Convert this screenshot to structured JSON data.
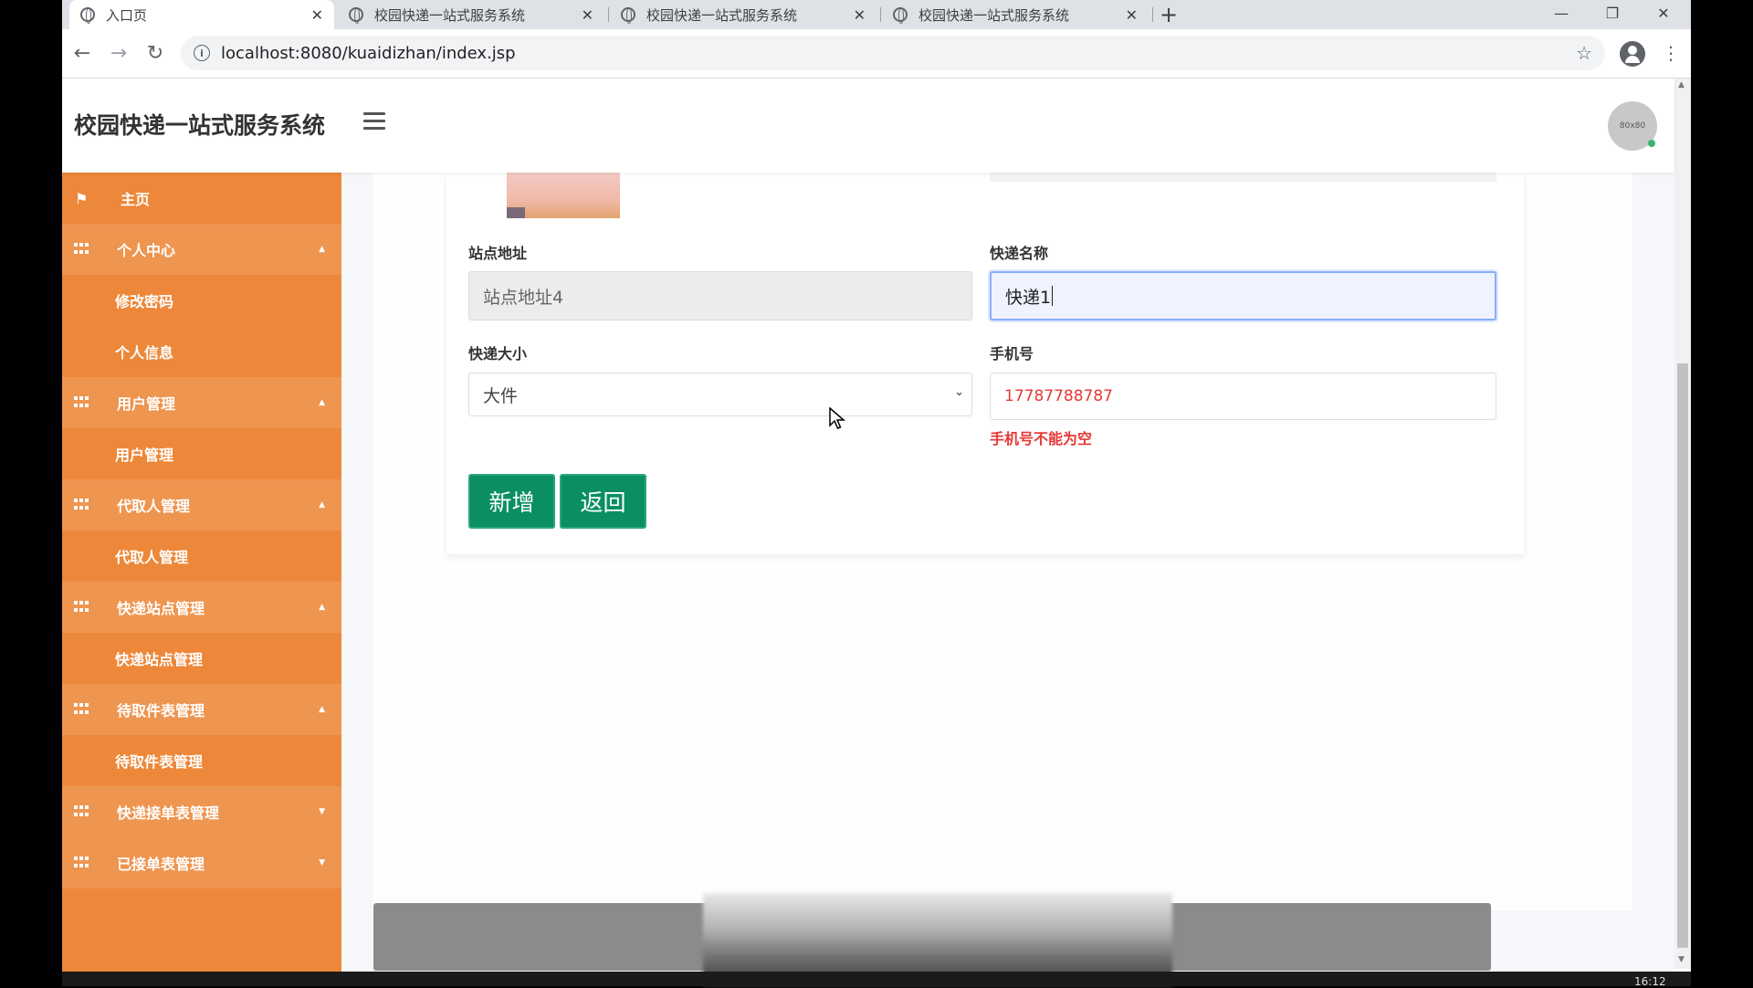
{
  "browser": {
    "tabs": [
      {
        "title": "入口页",
        "active": true
      },
      {
        "title": "校园快递一站式服务系统",
        "active": false
      },
      {
        "title": "校园快递一站式服务系统",
        "active": false
      },
      {
        "title": "校园快递一站式服务系统",
        "active": false
      }
    ],
    "url": "localhost:8080/kuaidizhan/index.jsp"
  },
  "app": {
    "title": "校园快递一站式服务系统",
    "avatar_text": "80x80"
  },
  "sidebar": {
    "home": "主页",
    "groups": [
      {
        "label": "个人中心",
        "children": [
          "修改密码",
          "个人信息"
        ]
      },
      {
        "label": "用户管理",
        "children": [
          "用户管理"
        ]
      },
      {
        "label": "代取人管理",
        "children": [
          "代取人管理"
        ]
      },
      {
        "label": "快递站点管理",
        "children": [
          "快递站点管理"
        ]
      },
      {
        "label": "待取件表管理",
        "children": [
          "待取件表管理"
        ]
      },
      {
        "label": "快递接单表管理",
        "children": []
      },
      {
        "label": "已接单表管理",
        "children": []
      }
    ]
  },
  "form": {
    "station_address": {
      "label": "站点地址",
      "value": "站点地址4"
    },
    "express_name": {
      "label": "快递名称",
      "value": "快递1"
    },
    "express_size": {
      "label": "快递大小",
      "value": "大件"
    },
    "phone": {
      "label": "手机号",
      "value": "17787788787",
      "error": "手机号不能为空"
    },
    "buttons": {
      "add": "新增",
      "back": "返回"
    }
  },
  "system": {
    "clock": "16:12"
  },
  "colors": {
    "sidebar": "#ed883a",
    "sidebar_parent": "#ee9550",
    "button": "#0b8f62",
    "error": "#e53935"
  }
}
